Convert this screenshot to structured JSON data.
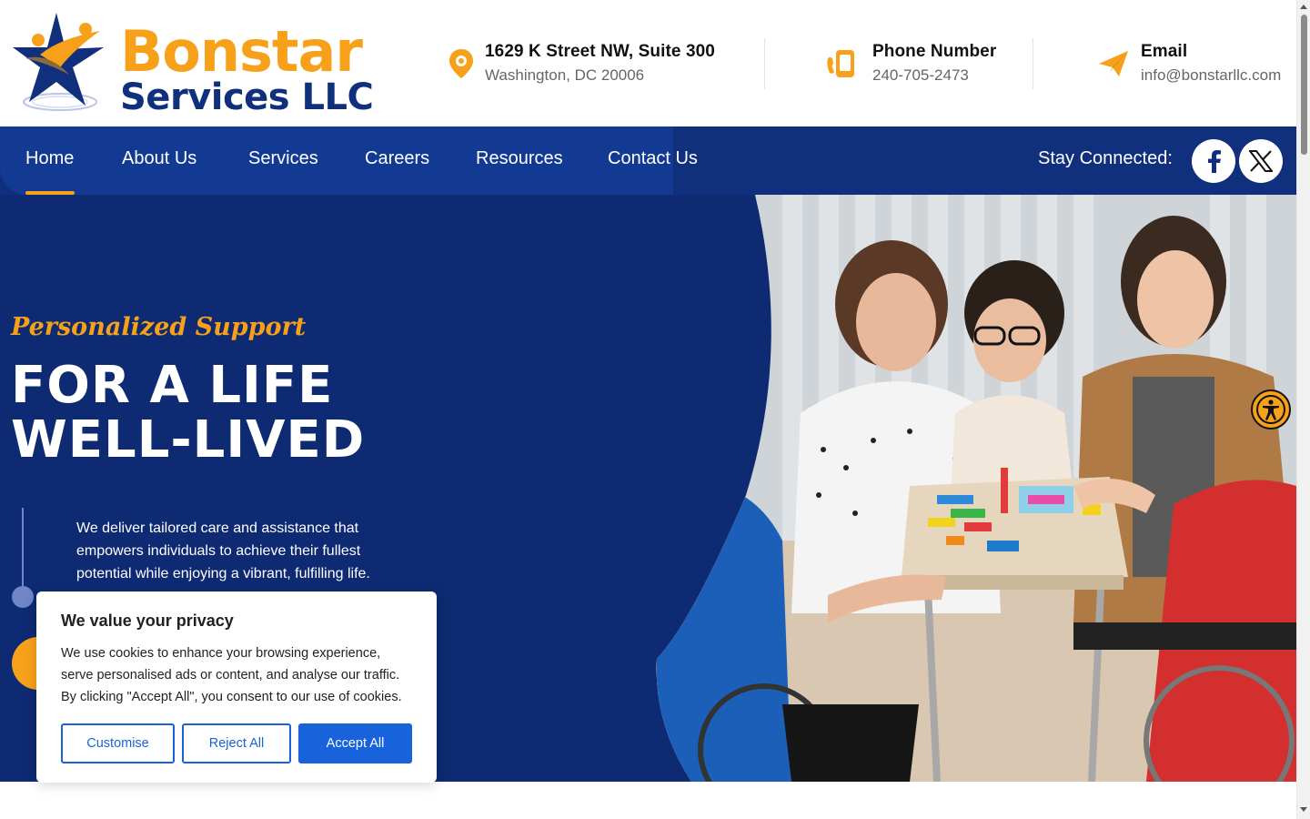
{
  "brand": {
    "name_line1": "Bonstar",
    "name_line2": "Services LLC",
    "orange": "#f7a11a",
    "navy": "#10307e"
  },
  "contact": {
    "address": {
      "icon": "location-pin-icon",
      "title": "1629 K Street NW, Suite 300",
      "sub": "Washington, DC 20006"
    },
    "phone": {
      "icon": "phone-icon",
      "title": "Phone Number",
      "sub": "240-705-2473"
    },
    "email": {
      "icon": "paper-plane-icon",
      "title": "Email",
      "sub": "info@bonstarllc.com"
    }
  },
  "nav": {
    "items": [
      {
        "label": "Home",
        "active": true
      },
      {
        "label": "About Us"
      },
      {
        "label": "Services"
      },
      {
        "label": "Careers"
      },
      {
        "label": "Resources"
      },
      {
        "label": "Contact Us"
      }
    ],
    "stay_connected": "Stay Connected:",
    "social": [
      {
        "icon": "facebook-icon"
      },
      {
        "icon": "x-twitter-icon"
      }
    ]
  },
  "hero": {
    "tagline": "Personalized Support",
    "headline_line1": "FOR A LIFE",
    "headline_line2": "WELL-LIVED",
    "description": "We deliver tailored care and assistance that empowers individuals to achieve their fullest potential while enjoying a vibrant, fulfilling life."
  },
  "cookie": {
    "title": "We value your privacy",
    "text": "We use cookies to enhance your browsing experience, serve personalised ads or content, and analyse our traffic. By clicking \"Accept All\", you consent to our use of cookies.",
    "customise": "Customise",
    "reject": "Reject All",
    "accept": "Accept All"
  },
  "accessibility": {
    "icon": "accessibility-icon"
  }
}
